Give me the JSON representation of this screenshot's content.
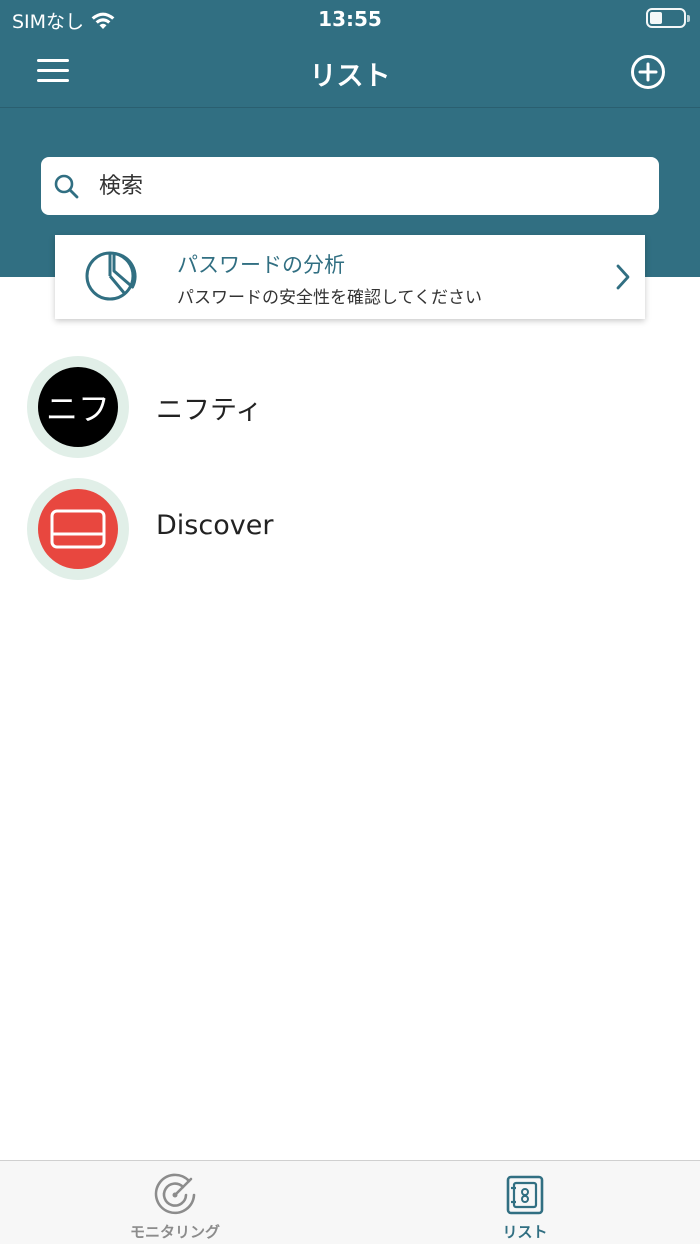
{
  "status_bar": {
    "carrier": "SIMなし",
    "time": "13:55"
  },
  "nav": {
    "title": "リスト",
    "menu_icon": "hamburger-icon",
    "add_icon": "plus-circle-icon"
  },
  "search": {
    "placeholder": "検索",
    "value": ""
  },
  "analysis": {
    "title": "パスワードの分析",
    "subtitle": "パスワードの安全性を確認してください",
    "icon": "pie-chart-icon"
  },
  "items": [
    {
      "label": "ニフティ",
      "avatar_text": "ニフ",
      "avatar_color": "#000000"
    },
    {
      "label": "Discover",
      "avatar_icon": "credit-card-icon",
      "avatar_color": "#e8473f"
    }
  ],
  "tabs": [
    {
      "label": "モニタリング",
      "icon": "radar-icon",
      "active": false
    },
    {
      "label": "リスト",
      "icon": "vault-icon",
      "active": true
    }
  ],
  "colors": {
    "primary": "#316f82",
    "avatar_ring": "#e1efe8",
    "tab_inactive": "#8c8c8c"
  }
}
